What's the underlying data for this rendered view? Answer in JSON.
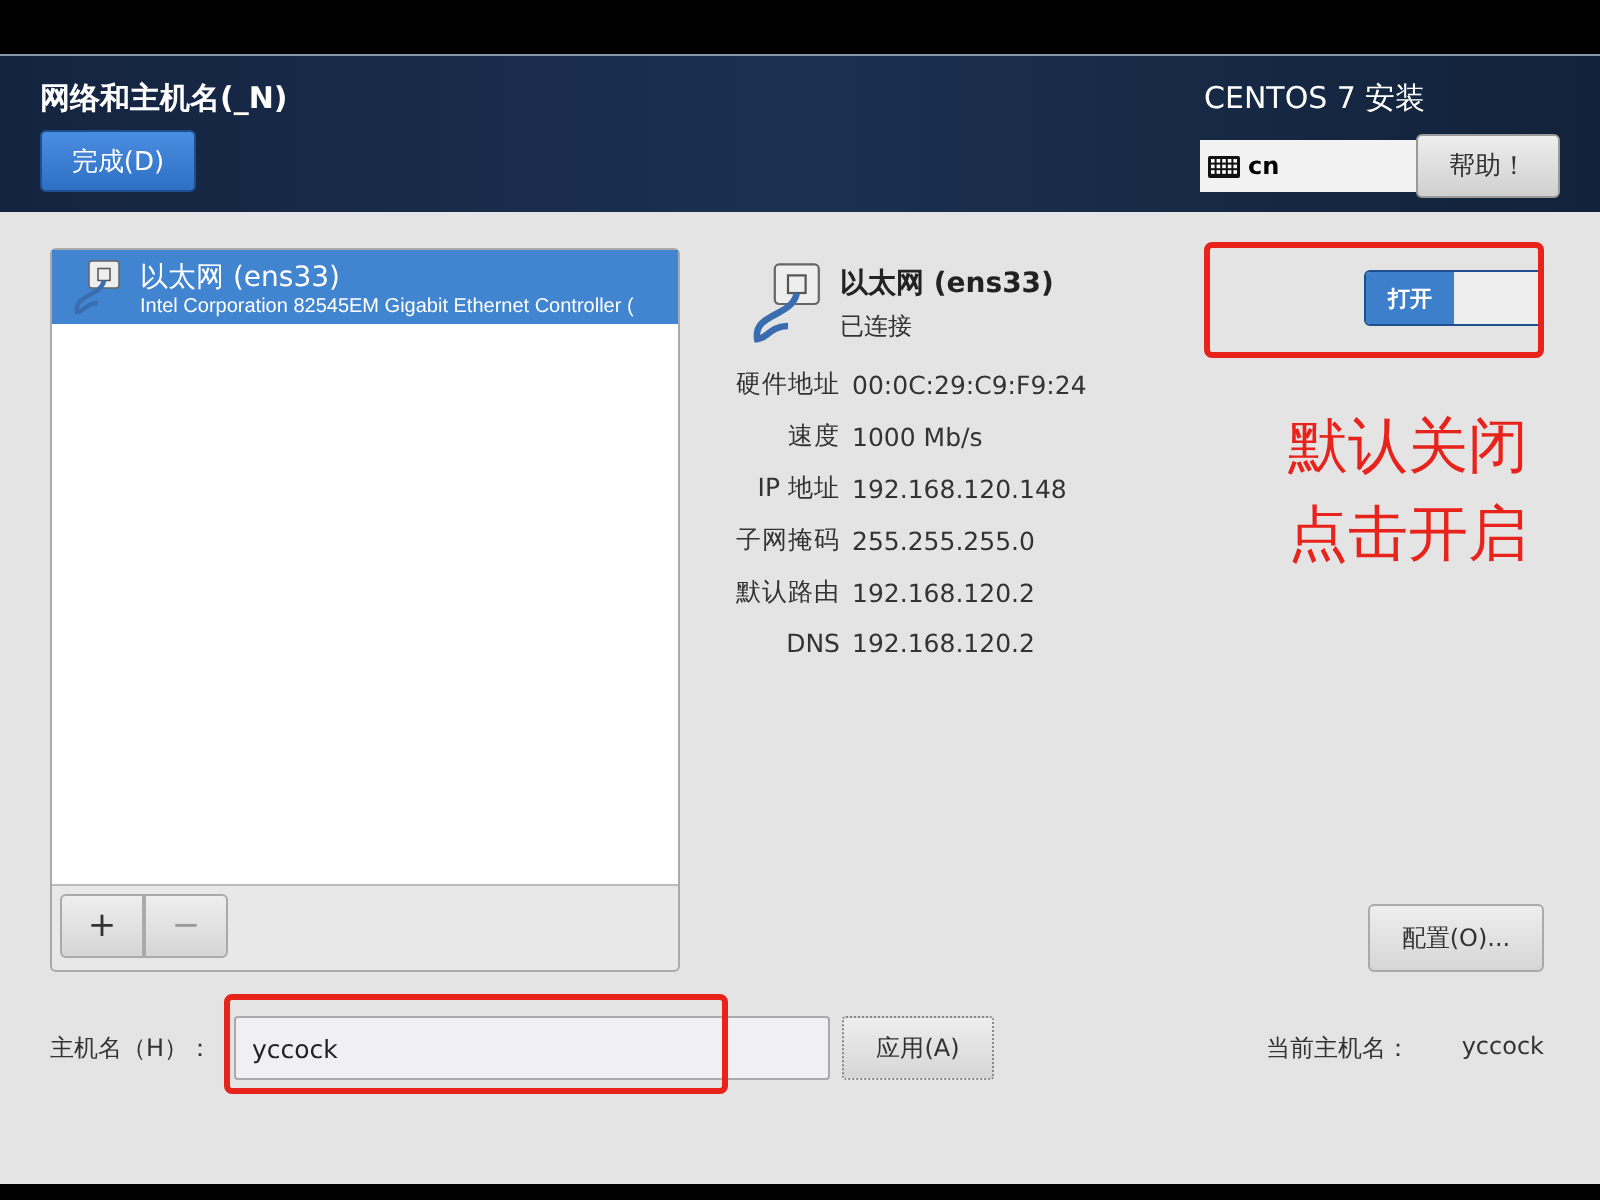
{
  "header": {
    "title": "网络和主机名(_N)",
    "done_button": "完成(D)",
    "product": "CENTOS 7 安装",
    "keyboard_layout": "cn",
    "help_button": "帮助！"
  },
  "devices": [
    {
      "name": "以太网 (ens33)",
      "description": "Intel Corporation 82545EM Gigabit Ethernet Controller (",
      "selected": true
    }
  ],
  "list_buttons": [
    "+",
    "−"
  ],
  "device_detail": {
    "name": "以太网 (ens33)",
    "status": "已连接",
    "toggle": {
      "label": "打开",
      "on": true
    },
    "properties": [
      {
        "label": "硬件地址",
        "value": "00:0C:29:C9:F9:24"
      },
      {
        "label": "速度",
        "value": "1000 Mb/s"
      },
      {
        "label": "IP 地址",
        "value": "192.168.120.148"
      },
      {
        "label": "子网掩码",
        "value": "255.255.255.0"
      },
      {
        "label": "默认路由",
        "value": "192.168.120.2"
      },
      {
        "label": "DNS",
        "value": "192.168.120.2"
      }
    ],
    "configure_button": "配置(O)..."
  },
  "annotation": {
    "lines": [
      "默认关闭",
      "点击开启"
    ]
  },
  "hostname": {
    "label": "主机名（H）：",
    "value": "yccock",
    "apply_button": "应用(A)",
    "current_label": "当前主机名：",
    "current_value": "yccock"
  }
}
